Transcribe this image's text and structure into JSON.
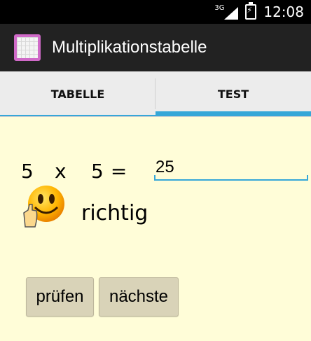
{
  "status": {
    "network": "3G",
    "time": "12:08"
  },
  "app": {
    "title": "Multiplikationstabelle"
  },
  "tabs": [
    {
      "label": "TABELLE",
      "selected": false
    },
    {
      "label": "TEST",
      "selected": true
    }
  ],
  "question": {
    "a": "5",
    "op": "x",
    "b": "5",
    "equals": "="
  },
  "answer": {
    "value": "25"
  },
  "feedback": {
    "icon": "thumbs-up-smiley-icon",
    "text": "richtig"
  },
  "buttons": {
    "check": "prüfen",
    "next": "nächste"
  },
  "colors": {
    "accent": "#35a7d8",
    "background": "#fffdd8",
    "button": "#d9d3b8"
  }
}
